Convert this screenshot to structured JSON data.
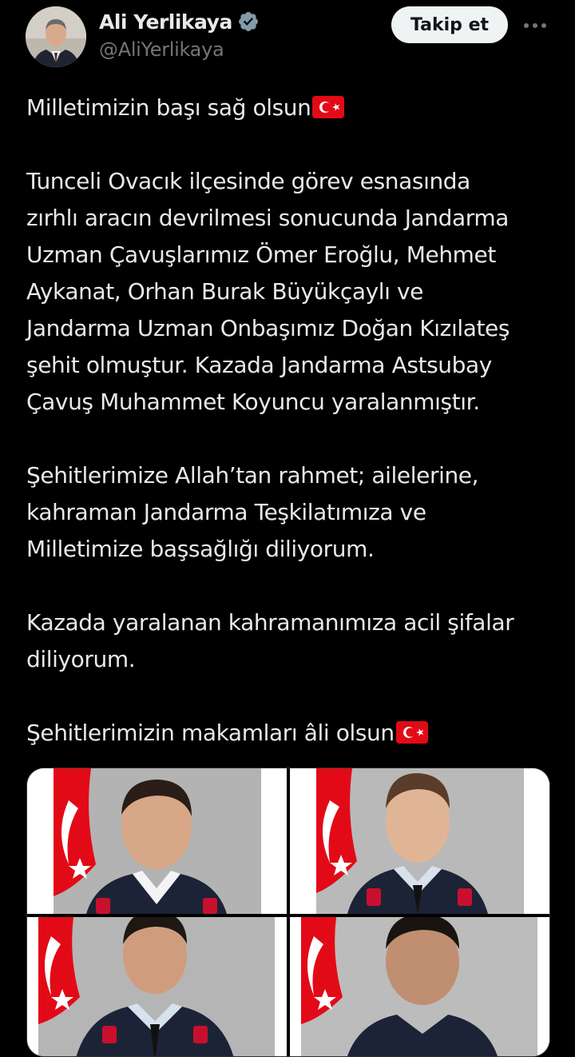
{
  "author": {
    "display_name": "Ali Yerlikaya",
    "handle": "@AliYerlikaya",
    "verified": true
  },
  "actions": {
    "follow_label": "Takip et",
    "more_icon": "more-dots-icon"
  },
  "tweet": {
    "p1": "Milletimizin başı sağ olsun",
    "p2_lines": [
      "Tunceli Ovacık ilçesinde görev esnasında",
      "zırhlı aracın devrilmesi sonucunda Jandarma",
      "Uzman Çavuşlarımız Ömer Eroğlu, Mehmet",
      "Aykanat, Orhan Burak Büyükçaylı ve",
      "Jandarma Uzman Onbaşımız Doğan Kızılateş",
      "şehit olmuştur. Kazada Jandarma Astsubay",
      "Çavuş Muhammet Koyuncu yaralanmıştır."
    ],
    "p3_lines": [
      "Şehitlerimize Allah’tan rahmet; ailelerine,",
      "kahraman Jandarma Teşkilatımıza ve",
      "Milletimize başsağlığı diliyorum."
    ],
    "p4_lines": [
      "Kazada yaralanan kahramanımıza acil şifalar",
      "diliyorum."
    ],
    "p5": "Şehitlerimizin makamları âli olsun"
  },
  "flag_emoji": "turkey-flag-icon",
  "media": {
    "photo_count": 4,
    "photos": [
      "soldier-photo-1",
      "soldier-photo-2",
      "soldier-photo-3",
      "soldier-photo-4"
    ]
  },
  "colors": {
    "background": "#000000",
    "text": "#e7e9ea",
    "secondary_text": "#71767b",
    "verified": "#829aab",
    "follow_bg": "#eff3f4",
    "flag_red": "#e30a17",
    "photo_bg": "#b8b8b8",
    "uniform": "#1d2336"
  }
}
